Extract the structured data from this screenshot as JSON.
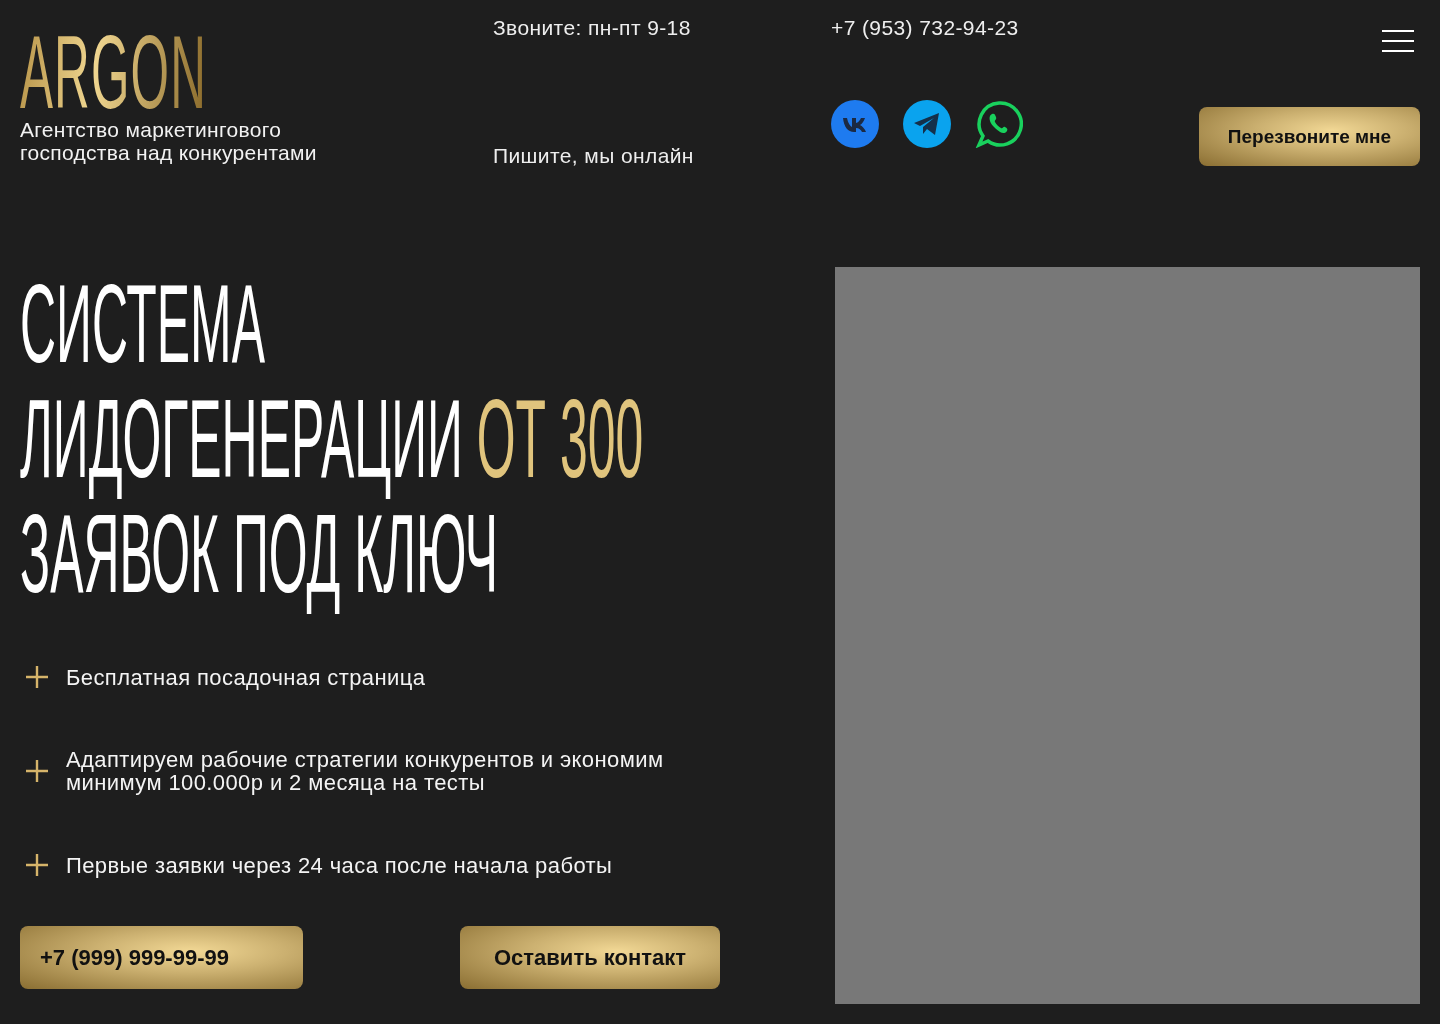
{
  "header": {
    "logo": "ARGON",
    "tagline": "Агентство маркетингового господства над конкурентами",
    "hours": "Звоните: пн-пт 9-18",
    "phone": "+7 (953) 732-94-23",
    "online": "Пишите, мы онлайн",
    "callback_button": "Перезвоните мне"
  },
  "hero": {
    "heading": [
      [
        {
          "text": "СИСТЕМА",
          "accent": false
        }
      ],
      [
        {
          "text": "ЛИДОГЕНЕРАЦИИ ",
          "accent": false
        },
        {
          "text": "ОТ 300",
          "accent": true
        }
      ],
      [
        {
          "text": "ЗАЯВОК ПОД КЛЮЧ",
          "accent": false
        }
      ]
    ],
    "benefits": [
      "Бесплатная посадочная страница",
      "Адаптируем рабочие стратегии конкурентов и экономим минимум 100.000р и 2 месяца на тесты",
      "Первые заявки через 24 часа после начала работы"
    ],
    "phone_field": {
      "placeholder": "+7 (999) 999-99-99"
    },
    "submit_button": "Оставить контакт"
  }
}
